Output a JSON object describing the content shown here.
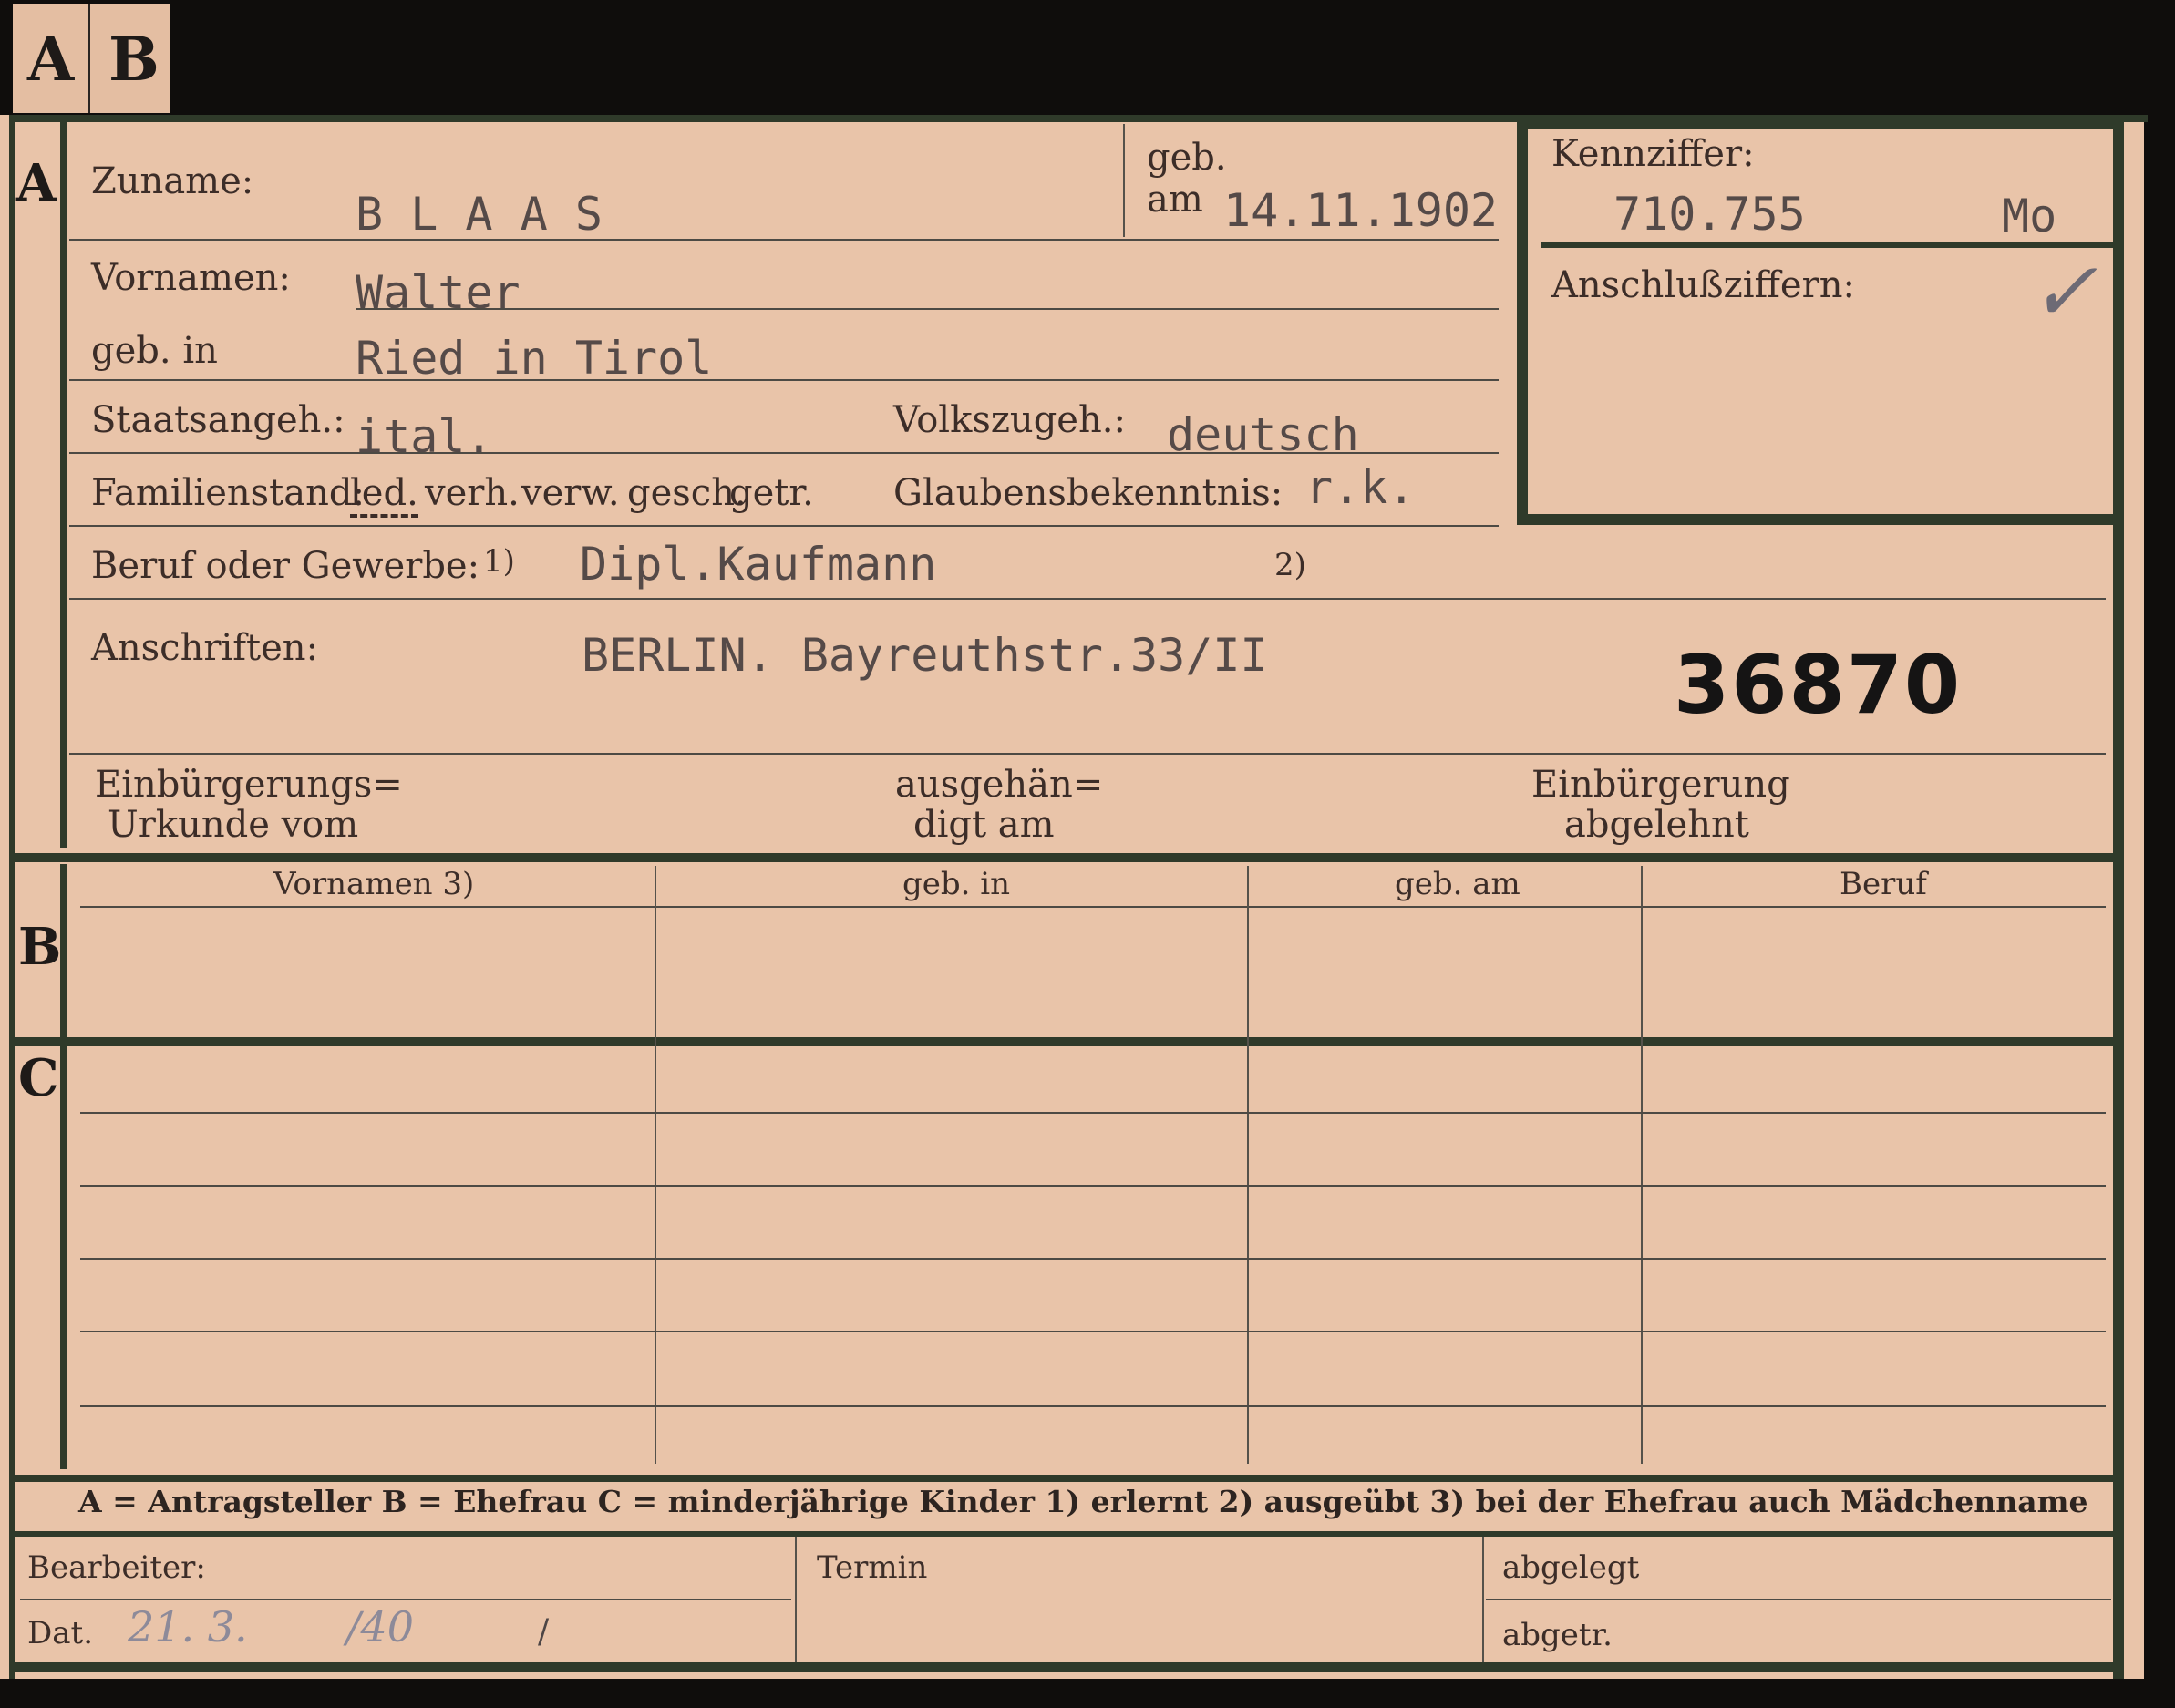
{
  "tabs": {
    "a": "A",
    "b": "B"
  },
  "sections": {
    "a": "A",
    "b": "B",
    "c": "C"
  },
  "header": {
    "surname_label": "Zuname:",
    "surname": "B L A A S",
    "dob_label_geb": "geb.",
    "dob_label_am": "am",
    "dob": "14.11.1902",
    "ref_label": "Kennziffer:",
    "ref_number": "710.755",
    "ref_suffix": "Mo",
    "linked_label": "Anschlußziffern:",
    "linked_mark": "✓"
  },
  "person": {
    "first_names_label": "Vornamen:",
    "first_names": "Walter",
    "birthplace_label": "geb. in",
    "birthplace": "Ried in Tirol",
    "nationality_label": "Staatsangeh.:",
    "nationality": "ital.",
    "ethnicity_label": "Volkszugeh.:",
    "ethnicity": "deutsch",
    "marital_label": "Familienstand:",
    "marital_options": [
      "led.",
      "verh.",
      "verw.",
      "gesch.",
      "getr."
    ],
    "religion_label": "Glaubensbekenntnis:",
    "religion": "r.k.",
    "occupation_label": "Beruf oder Gewerbe:",
    "footnote_1": "1)",
    "occupation": "Dipl.Kaufmann",
    "footnote_2": "2)",
    "address_label": "Anschriften:",
    "address": "BERLIN. Bayreuthstr.33/II",
    "stamp_number": "36870"
  },
  "naturalization": {
    "certificate_label_1": "Einbürgerungs=",
    "certificate_label_2": "Urkunde vom",
    "handed_label_1": "ausgehän=",
    "handed_label_2": "digt am",
    "refused_label_1": "Einbürgerung",
    "refused_label_2": "abgelehnt"
  },
  "table": {
    "columns": [
      "Vornamen 3)",
      "geb. in",
      "geb. am",
      "Beruf"
    ]
  },
  "legend": {
    "text": "A = Antragsteller   B = Ehefrau   C = minderjährige Kinder   1) erlernt   2) ausgeübt   3) bei der Ehefrau auch Mädchenname"
  },
  "footer": {
    "clerk_label": "Bearbeiter:",
    "date_label": "Dat.",
    "date_handwritten": "21. 3.",
    "date_year": "/40",
    "date_slash": "/",
    "deadline_label": "Termin",
    "filed_label": "abgelegt",
    "sent_label": "abgetr."
  }
}
